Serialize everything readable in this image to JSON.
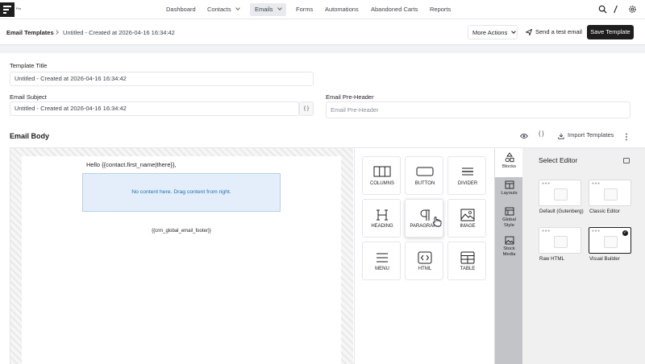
{
  "topnav": {
    "logo_suffix": "Pro",
    "items": [
      {
        "label": "Dashboard"
      },
      {
        "label": "Contacts"
      },
      {
        "label": "Emails"
      },
      {
        "label": "Forms"
      },
      {
        "label": "Automations"
      },
      {
        "label": "Abandoned Carts"
      },
      {
        "label": "Reports"
      }
    ],
    "active_item": "Emails",
    "icons": [
      "search-icon",
      "edit-icon",
      "settings-icon"
    ]
  },
  "header": {
    "breadcrumb_root": "Email Templates",
    "breadcrumb_current": "Untitled - Created at 2026-04-16 16:34:42",
    "more_actions_label": "More Actions",
    "send_test_label": "Send a test email",
    "save_label": "Save Template"
  },
  "form": {
    "template_title_label": "Template Title",
    "template_title_value": "Untitled - Created at 2026-04-16 16:34:42",
    "subject_label": "Email Subject",
    "subject_value": "Untitled - Created at 2026-04-16 16:34:42",
    "merge_tag_label": "{ }",
    "preheader_label": "Email Pre-Header",
    "preheader_placeholder": "Email Pre-Header"
  },
  "email_body": {
    "title": "Email Body",
    "code_toggle_label": "{ }",
    "import_label": "Import Templates"
  },
  "canvas": {
    "greeting": "Hello {{contact.first_name|there}},",
    "dropzone_text": "No content here. Drag content from right.",
    "footer_tag": "{{crm_global_email_footer}}"
  },
  "blocks": [
    {
      "label": "COLUMNS",
      "icon": "columns-icon"
    },
    {
      "label": "BUTTON",
      "icon": "button-icon"
    },
    {
      "label": "DIVIDER",
      "icon": "divider-icon"
    },
    {
      "label": "HEADING",
      "icon": "heading-icon"
    },
    {
      "label": "PARAGRAPH",
      "icon": "paragraph-icon"
    },
    {
      "label": "IMAGE",
      "icon": "image-icon"
    },
    {
      "label": "MENU",
      "icon": "menu-icon"
    },
    {
      "label": "HTML",
      "icon": "html-icon"
    },
    {
      "label": "TABLE",
      "icon": "table-icon"
    }
  ],
  "side_tabs": [
    {
      "label": "Blocks",
      "icon": "shapes-icon",
      "active": true
    },
    {
      "label": "Layouts",
      "icon": "layouts-icon"
    },
    {
      "label": "Global Style",
      "icon": "global-style-icon"
    },
    {
      "label": "Stock Media",
      "icon": "stock-media-icon"
    }
  ],
  "select_editor": {
    "title": "Select Editor",
    "options": [
      {
        "label": "Default (Gutenberg)"
      },
      {
        "label": "Classic Editor"
      },
      {
        "label": "Raw HTML"
      },
      {
        "label": "Visual Builder",
        "selected": true
      }
    ]
  },
  "colors": {
    "primary_dark": "#1e1e1e",
    "dropzone_bg": "#e3eefa",
    "dropzone_text": "#2271b1",
    "side_tabs_bg": "#c3c4c7"
  }
}
